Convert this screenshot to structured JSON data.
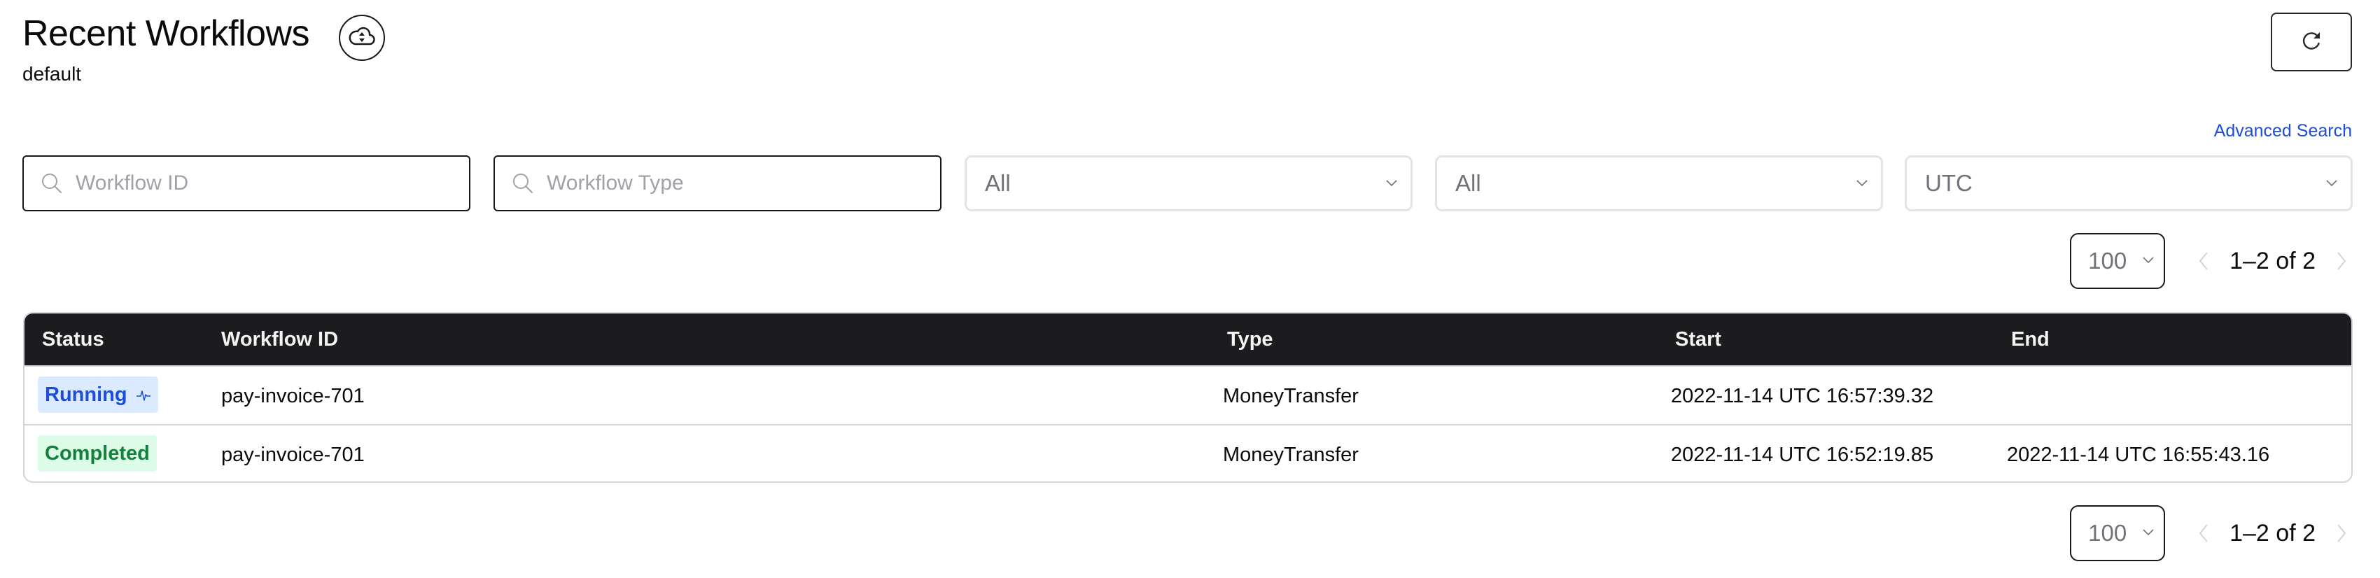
{
  "header": {
    "title": "Recent Workflows",
    "namespace": "default",
    "cloud_icon": "cloud-archive-icon",
    "refresh_icon": "refresh-icon"
  },
  "filters": {
    "advanced_search_label": "Advanced Search",
    "workflow_id": {
      "placeholder": "Workflow ID",
      "value": "",
      "icon": "search-icon"
    },
    "workflow_type": {
      "placeholder": "Workflow Type",
      "value": "",
      "icon": "search-icon"
    },
    "time_range": {
      "value": "All"
    },
    "status": {
      "value": "All"
    },
    "timezone": {
      "value": "UTC"
    }
  },
  "pagination": {
    "page_size": "100",
    "range_label": "1–2 of 2",
    "prev_icon": "chevron-left-icon",
    "next_icon": "chevron-right-icon"
  },
  "table": {
    "columns": [
      "Status",
      "Workflow ID",
      "Type",
      "Start",
      "End"
    ],
    "rows": [
      {
        "status": "Running",
        "status_icon": "heartbeat-icon",
        "workflow_id": "pay-invoice-701",
        "type": "MoneyTransfer",
        "start": "2022-11-14 UTC 16:57:39.32",
        "end": ""
      },
      {
        "status": "Completed",
        "workflow_id": "pay-invoice-701",
        "type": "MoneyTransfer",
        "start": "2022-11-14 UTC 16:52:19.85",
        "end": "2022-11-14 UTC 16:55:43.16"
      }
    ]
  },
  "colors": {
    "running_text": "#1d4ed8",
    "running_bg": "#dbeafe",
    "completed_text": "#15803d",
    "completed_bg": "#dcfce7",
    "link": "#1d4ed8",
    "table_header_bg": "#1c1c1e"
  }
}
